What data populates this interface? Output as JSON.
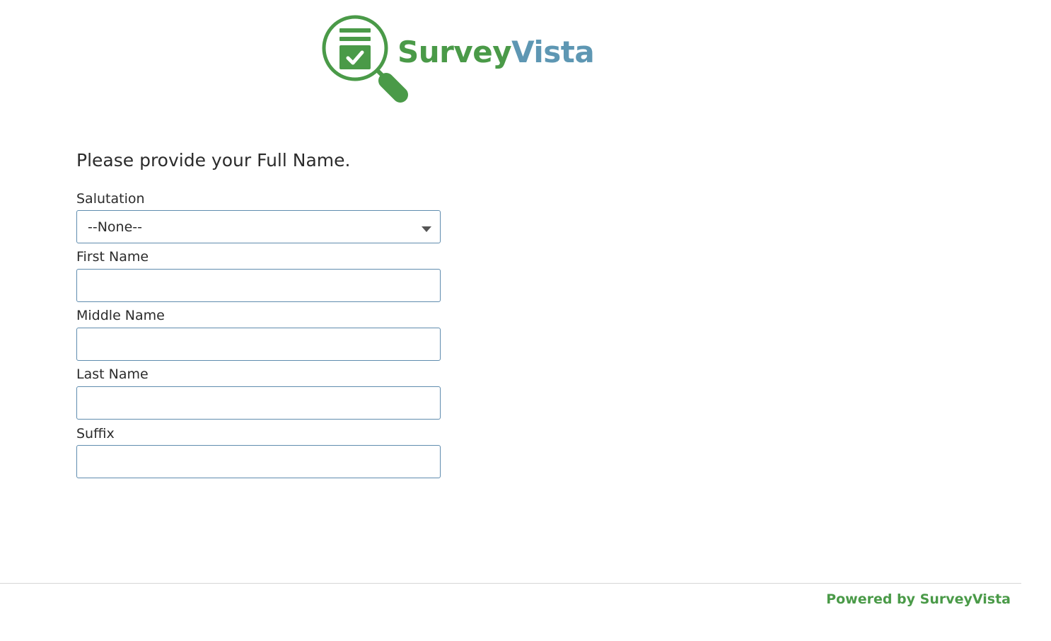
{
  "brand": {
    "name_part1": "Survey",
    "name_part2": "Vista",
    "logo_icon": "magnifier-clipboard-check-icon",
    "green": "#4a9a48",
    "blue": "#5e97b3"
  },
  "question": {
    "text": "Please provide your Full Name."
  },
  "fields": {
    "salutation": {
      "label": "Salutation",
      "selected": "--None--"
    },
    "first_name": {
      "label": "First Name",
      "value": ""
    },
    "middle_name": {
      "label": "Middle Name",
      "value": ""
    },
    "last_name": {
      "label": "Last Name",
      "value": ""
    },
    "suffix": {
      "label": "Suffix",
      "value": ""
    }
  },
  "footer": {
    "powered_by": "Powered by SurveyVista"
  }
}
